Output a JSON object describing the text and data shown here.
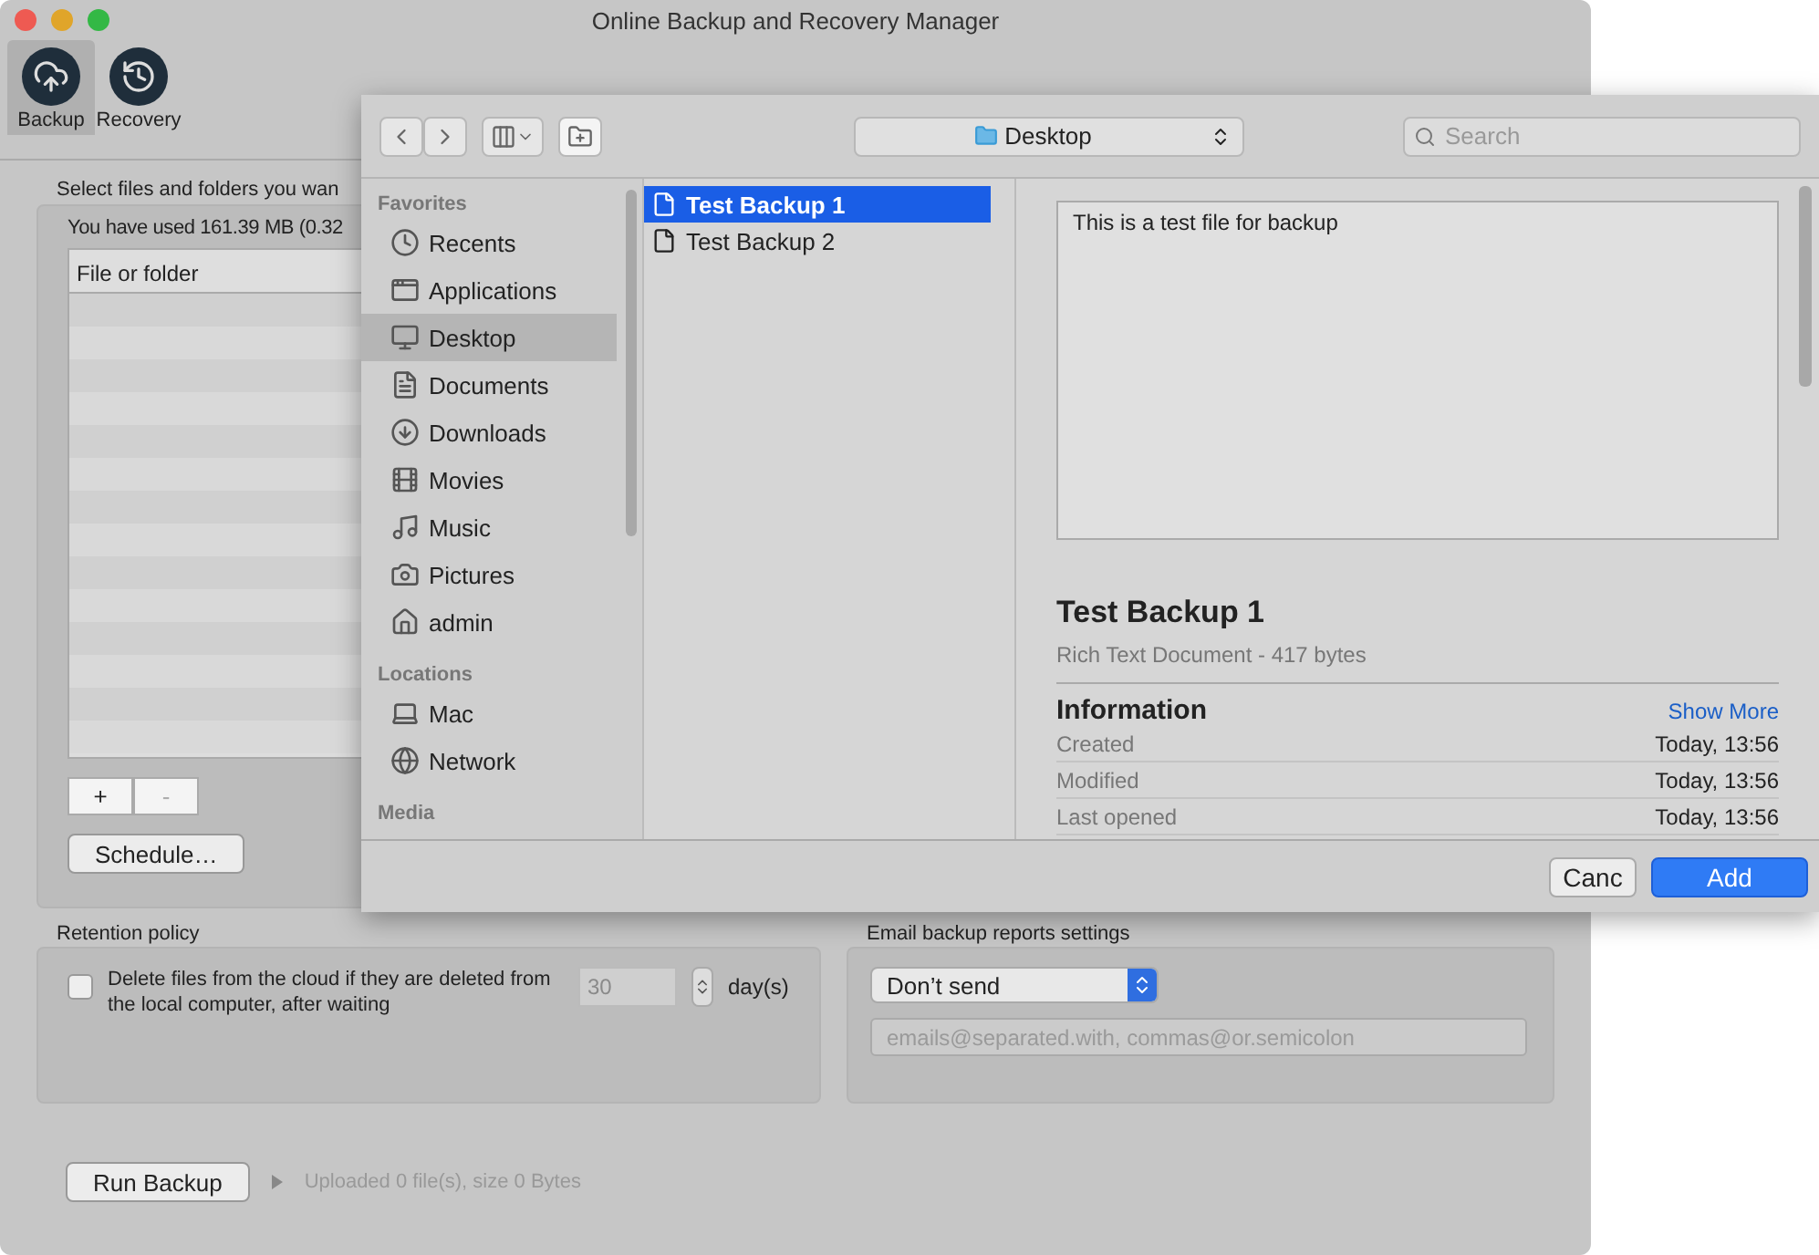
{
  "window": {
    "title": "Online Backup and Recovery Manager"
  },
  "toolbar": [
    {
      "label": "Backup",
      "selected": true
    },
    {
      "label": "Recovery",
      "selected": false
    }
  ],
  "backup": {
    "instruction": "Select files and folders you wan",
    "usage": "You have used 161.39 MB (0.32",
    "table": {
      "columns": [
        "File or folder"
      ]
    },
    "add_button": {
      "label": "+",
      "disabled": false
    },
    "remove_button": {
      "label": "-",
      "disabled": true
    },
    "schedule_button": "Schedule…"
  },
  "retention": {
    "title": "Retention policy",
    "checkbox": {
      "label": "Delete files from the cloud if they are deleted from the local computer, after waiting",
      "checked": false
    },
    "days": {
      "value": "30",
      "disabled": true,
      "unit": "day(s)"
    }
  },
  "email": {
    "title": "Email backup reports settings",
    "select": "Don’t send",
    "emails": {
      "placeholder": "emails@separated.with, commas@or.semicolon"
    }
  },
  "run_button": "Run Backup",
  "status": "Uploaded 0 file(s), size 0 Bytes",
  "dialog": {
    "location": "Desktop",
    "search": {
      "placeholder": "Search"
    },
    "sidebar": [
      {
        "heading": "Favorites",
        "items": [
          {
            "label": "Recents",
            "selected": false
          },
          {
            "label": "Applications",
            "selected": false
          },
          {
            "label": "Desktop",
            "selected": true
          },
          {
            "label": "Documents",
            "selected": false
          },
          {
            "label": "Downloads",
            "selected": false
          },
          {
            "label": "Movies",
            "selected": false
          },
          {
            "label": "Music",
            "selected": false
          },
          {
            "label": "Pictures",
            "selected": false
          },
          {
            "label": "admin",
            "selected": false
          }
        ]
      },
      {
        "heading": "Locations",
        "items": [
          {
            "label": "Mac",
            "selected": false
          },
          {
            "label": "Network",
            "selected": false
          }
        ]
      },
      {
        "heading": "Media"
      }
    ],
    "files": [
      {
        "name": "Test Backup 1",
        "selected": true
      },
      {
        "name": "Test Backup 2",
        "selected": false
      }
    ],
    "preview": {
      "content": "This is a test file for backup",
      "title": "Test Backup 1",
      "subtitle": "Rich Text Document - 417 bytes",
      "section": "Information",
      "show_more": "Show More",
      "rows": [
        {
          "label": "Created",
          "value": "Today, 13:56"
        },
        {
          "label": "Modified",
          "value": "Today, 13:56"
        },
        {
          "label": "Last opened",
          "value": "Today, 13:56"
        }
      ]
    },
    "cancel_button": "Canc",
    "add_button": "Add"
  }
}
